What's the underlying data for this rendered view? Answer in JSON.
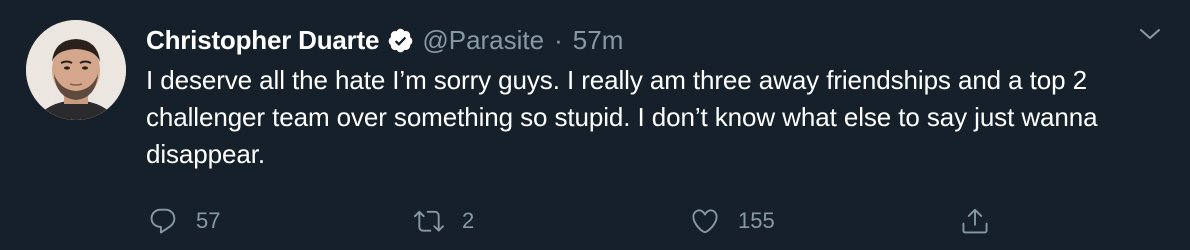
{
  "tweet": {
    "author": {
      "display_name": "Christopher Duarte",
      "handle": "@Parasite",
      "verified": true
    },
    "separator": "·",
    "timestamp": "57m",
    "text": "I deserve all the hate I’m sorry guys. I really am three away friendships and a top 2 challenger team over something so stupid. I don’t know what else to say just wanna disappear.",
    "actions": {
      "reply_count": "57",
      "retweet_count": "2",
      "like_count": "155"
    }
  },
  "colors": {
    "background": "#15202b",
    "primary_text": "#ffffff",
    "secondary_text": "#8899a6",
    "verified_badge": "#ffffff"
  },
  "icons": {
    "menu": "chevron-down-icon",
    "verified": "verified-badge-icon",
    "reply": "reply-icon",
    "retweet": "retweet-icon",
    "like": "heart-icon",
    "share": "share-icon"
  }
}
